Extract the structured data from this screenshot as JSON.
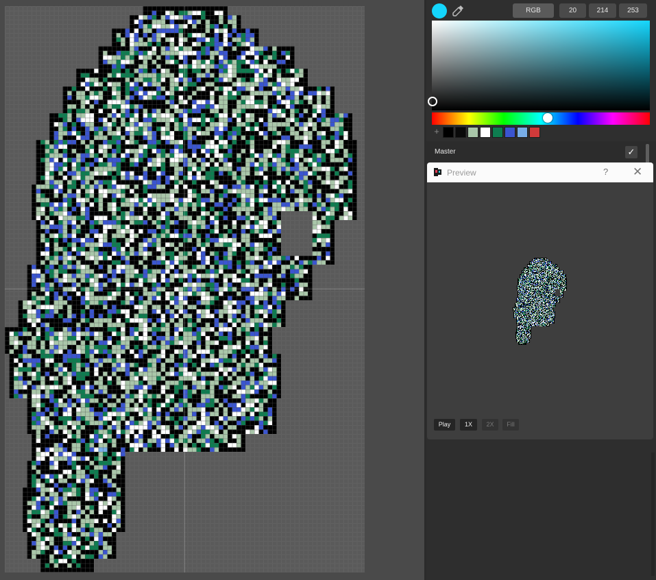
{
  "color_picker": {
    "current_color": "#14d6fd",
    "mode_label": "RGB",
    "r": "20",
    "g": "214",
    "b": "253",
    "hue_position_fraction": 0.53
  },
  "palette": {
    "add_label": "+",
    "colors": [
      "#000000",
      "#0a0a0a",
      "#a9c6a9",
      "#ffffff",
      "#0e7d50",
      "#3a55d0",
      "#78aee8",
      "#d13a3a"
    ]
  },
  "layer": {
    "name": "Master",
    "visible_check": "✓"
  },
  "preview": {
    "title": "Preview",
    "help": "?",
    "close": "✕",
    "buttons": {
      "play": "Play",
      "one_x": "1X",
      "two_x": "2X",
      "fill": "Fill"
    }
  },
  "sprite_colors": {
    "outline": "#000000",
    "light": "#a9c6a9",
    "white": "#ffffff",
    "green": "#0e7d50",
    "blue": "#3a55d0",
    "sky": "#78aee8"
  }
}
